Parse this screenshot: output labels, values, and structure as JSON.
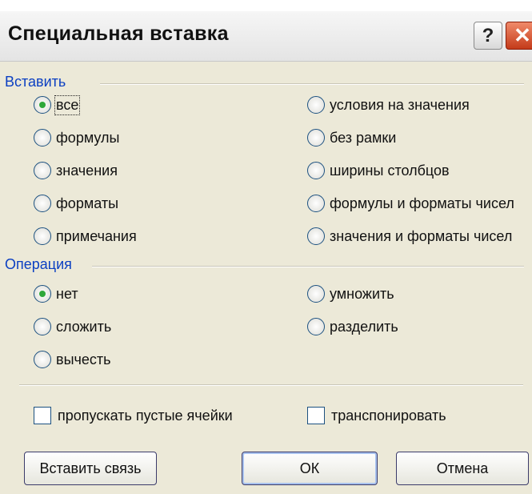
{
  "dialog": {
    "title": "Специальная вставка",
    "help_label": "?",
    "close_label": "✕"
  },
  "paste_group": {
    "title": "Вставить",
    "options": [
      {
        "label": "все",
        "checked": true
      },
      {
        "label": "формулы",
        "checked": false
      },
      {
        "label": "значения",
        "checked": false
      },
      {
        "label": "форматы",
        "checked": false
      },
      {
        "label": "примечания",
        "checked": false
      },
      {
        "label": "условия на значения",
        "checked": false
      },
      {
        "label": "без рамки",
        "checked": false
      },
      {
        "label": "ширины столбцов",
        "checked": false
      },
      {
        "label": "формулы и форматы чисел",
        "checked": false
      },
      {
        "label": "значения и форматы чисел",
        "checked": false
      }
    ]
  },
  "operation_group": {
    "title": "Операция",
    "options": [
      {
        "label": "нет",
        "checked": true
      },
      {
        "label": "сложить",
        "checked": false
      },
      {
        "label": "вычесть",
        "checked": false
      },
      {
        "label": "умножить",
        "checked": false
      },
      {
        "label": "разделить",
        "checked": false
      }
    ]
  },
  "checkboxes": {
    "skip_blanks": {
      "label": "пропускать пустые ячейки",
      "checked": false
    },
    "transpose": {
      "label": "транспонировать",
      "checked": false
    }
  },
  "buttons": {
    "paste_link": "Вставить связь",
    "ok": "ОК",
    "cancel": "Отмена"
  }
}
